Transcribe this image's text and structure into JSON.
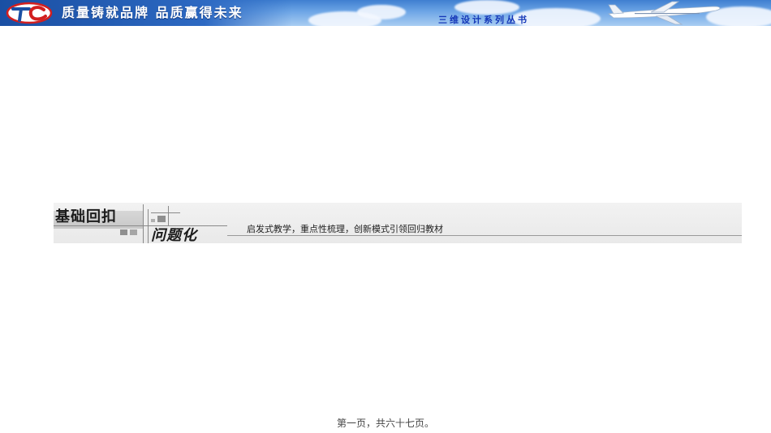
{
  "header": {
    "slogan": "质量铸就品牌 品质赢得未来",
    "series_name": "三维设计系列丛书",
    "logo_icon": "tc-logo-icon",
    "plane_icon": "airplane-icon",
    "colors": {
      "banner": "#3f7fd0",
      "series_text": "#1538b8"
    }
  },
  "section": {
    "title_line1": "基础回扣",
    "title_line2": "问题化",
    "subtitle": "启发式教学，重点性梳理，创新模式引领回归教材"
  },
  "footer": {
    "page_text": "第一页，共六十七页。"
  }
}
